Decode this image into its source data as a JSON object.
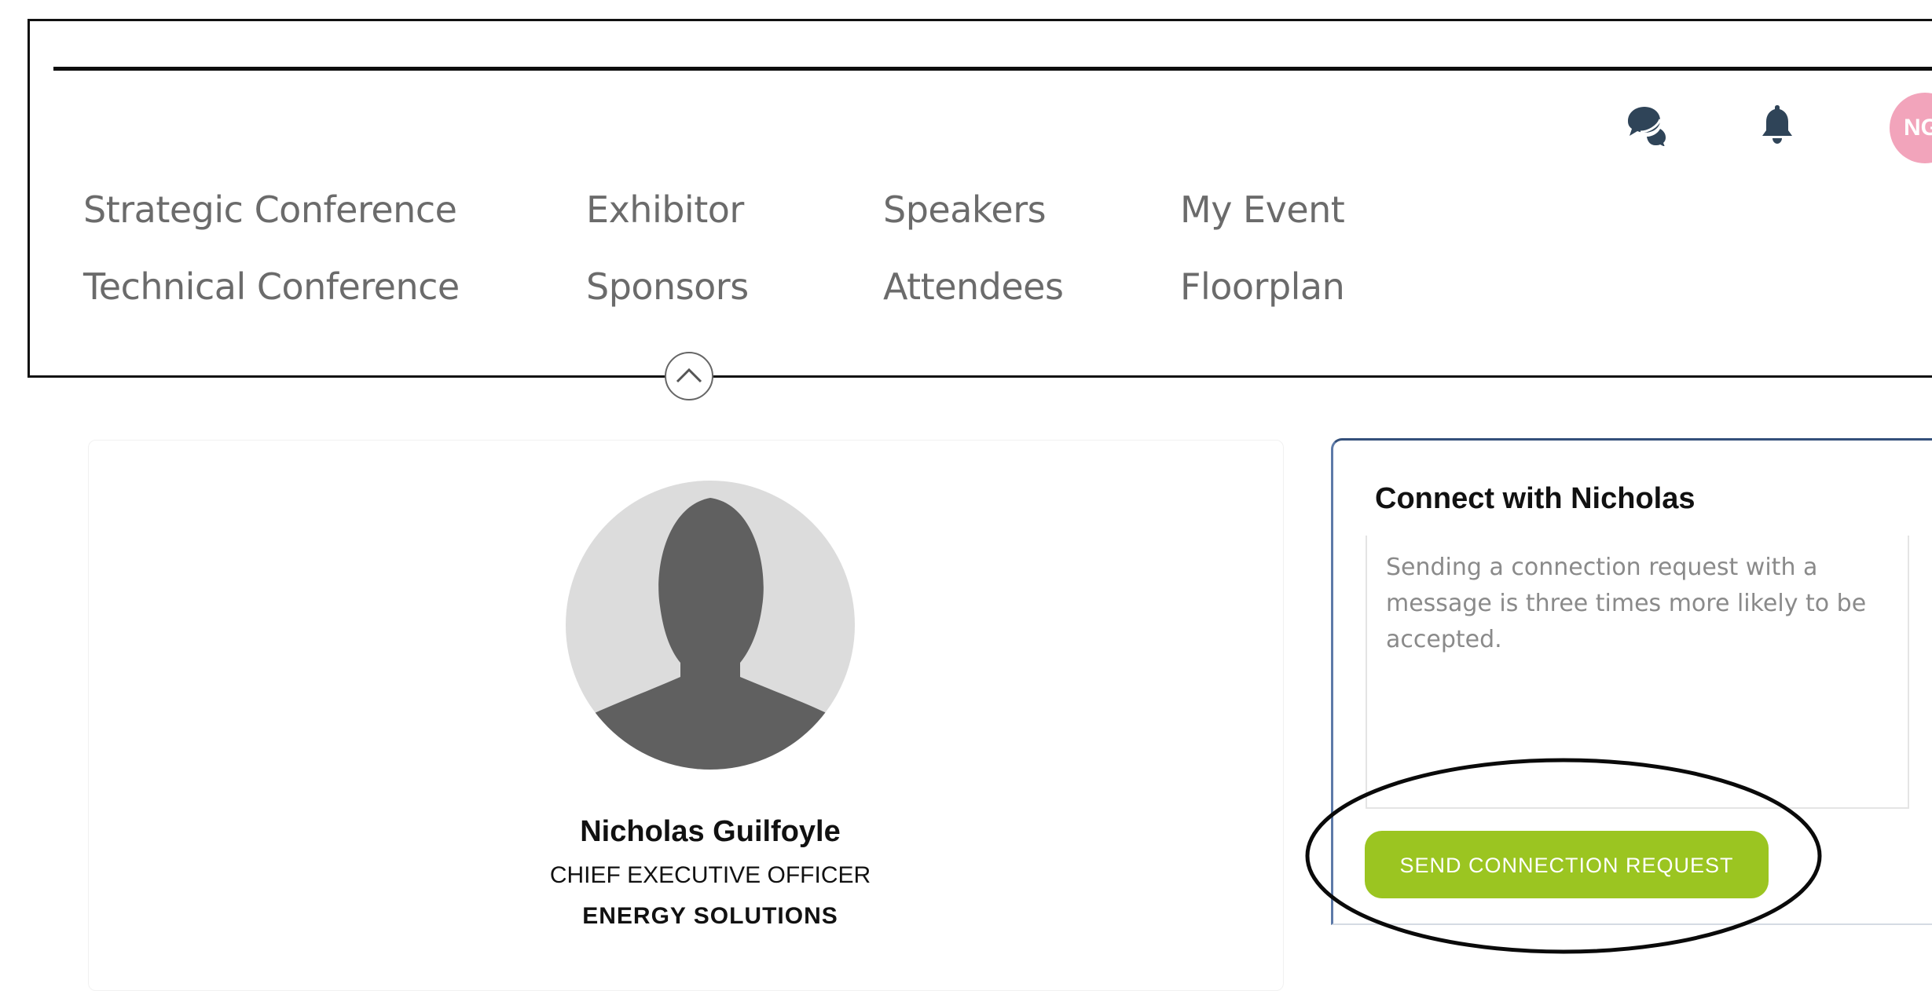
{
  "nav": {
    "col1": [
      "Strategic Conference",
      "Technical Conference"
    ],
    "col2": [
      "Exhibitor",
      "Sponsors"
    ],
    "col3": [
      "Speakers",
      "Attendees"
    ],
    "col4": [
      "My Event",
      "Floorplan"
    ]
  },
  "header_icons": [
    "chat-icon",
    "bell-icon"
  ],
  "user_avatar_initials": "NG",
  "profile": {
    "name": "Nicholas Guilfoyle",
    "title": "CHIEF EXECUTIVE OFFICER",
    "company": "ENERGY SOLUTIONS"
  },
  "connect": {
    "heading": "Connect with Nicholas",
    "placeholder": "Sending a connection request with a message is three times more likely to be accepted.",
    "button_label": "SEND CONNECTION REQUEST"
  },
  "colors": {
    "accent_button": "#9bc521",
    "icon": "#2f4458",
    "avatar": "#f2a4bb",
    "nav_text": "#6b6b6b"
  }
}
